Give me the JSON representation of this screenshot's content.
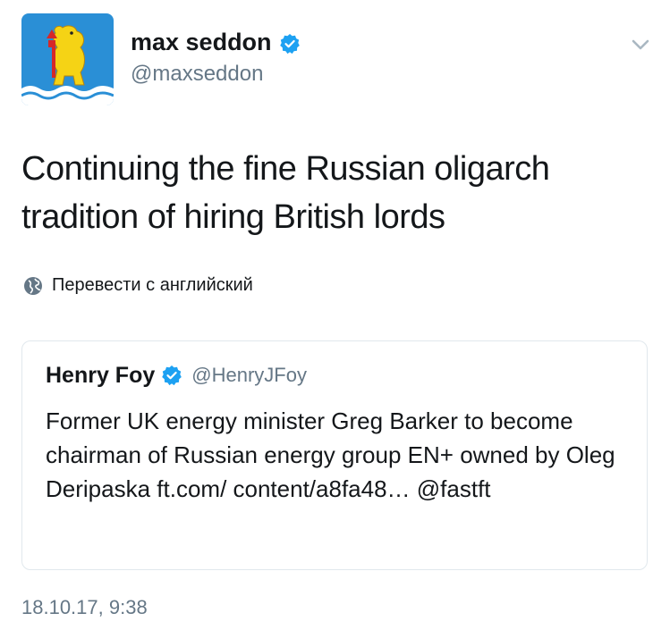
{
  "tweet": {
    "author_name": "max seddon",
    "author_handle": "@maxseddon",
    "text": "Continuing the fine Russian oligarch tradition of hiring British lords",
    "translate_label": "Перевести с английский",
    "timestamp": "18.10.17, 9:38"
  },
  "quoted_tweet": {
    "author_name": "Henry Foy",
    "author_handle": "@HenryJFoy",
    "text": "Former UK energy minister Greg Barker to become chairman of Russian energy group EN+ owned by Oleg Deripaska ft.com/ content/a8fa48… @fastft"
  },
  "icons": {
    "avatar": "bear-coat-of-arms-avatar",
    "verified": "verified-badge-icon",
    "menu": "chevron-down-icon",
    "translate": "globe-icon"
  },
  "colors": {
    "verified_blue": "#1da1f2",
    "secondary_text": "#657786",
    "border": "#e1e8ed",
    "avatar_bg": "#2a8fd6",
    "avatar_bear": "#f5d315"
  }
}
